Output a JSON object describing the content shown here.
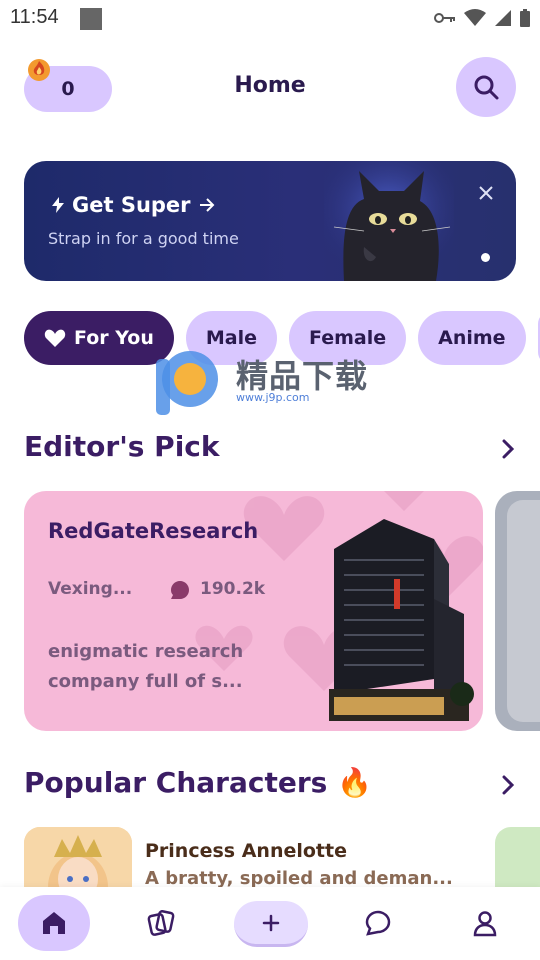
{
  "status_bar": {
    "time": "11:54"
  },
  "header": {
    "coins": "0",
    "title": "Home"
  },
  "banner": {
    "title": "Get Super",
    "subtitle": "Strap in for a good time"
  },
  "categories": [
    {
      "label": "For You",
      "active": true
    },
    {
      "label": "Male",
      "active": false
    },
    {
      "label": "Female",
      "active": false
    },
    {
      "label": "Anime",
      "active": false
    }
  ],
  "watermark": {
    "text": "精品下载",
    "url": "www.j9p.com"
  },
  "editors_pick": {
    "section_title": "Editor's Pick",
    "card": {
      "name": "RedGateResearch",
      "author": "Vexing...",
      "chat_count": "190.2k",
      "description": "enigmatic research company full of s..."
    }
  },
  "popular": {
    "section_title": "Popular Characters 🔥",
    "items": [
      {
        "name": "Princess Annelotte",
        "description": "A bratty, spoiled and deman..."
      }
    ]
  },
  "bottom_nav": {
    "items": [
      {
        "icon": "home-icon",
        "active": true
      },
      {
        "icon": "cards-icon",
        "active": false
      },
      {
        "icon": "plus-icon",
        "active": false
      },
      {
        "icon": "chat-icon",
        "active": false
      },
      {
        "icon": "profile-icon",
        "active": false
      }
    ]
  },
  "colors": {
    "accent": "#d9c7ff",
    "primary_dark": "#3b1d64",
    "banner": "#1e2a6a",
    "card_pink": "#f6b9d8"
  }
}
